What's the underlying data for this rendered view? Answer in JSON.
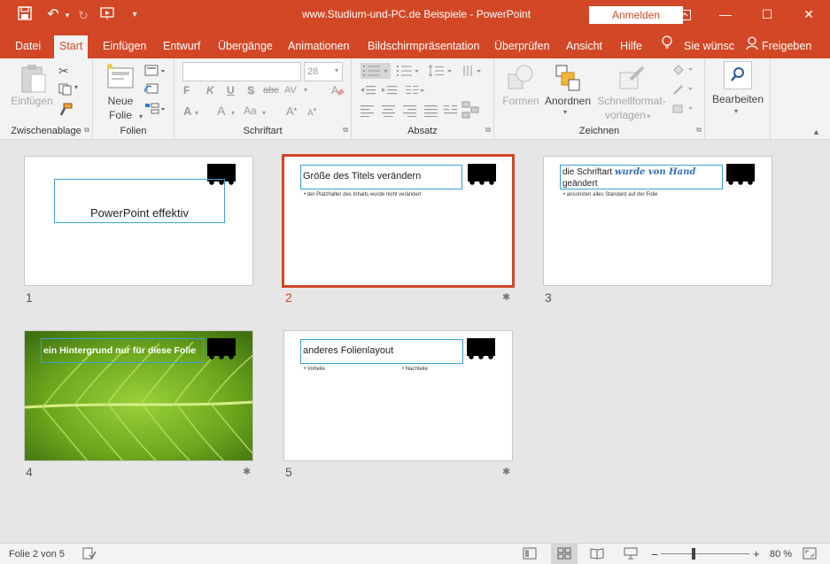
{
  "window": {
    "title": "www.Studium-und-PC.de  Beispiele  -  PowerPoint",
    "sign_in": "Anmelden",
    "restore_glyph": "⧉",
    "minimize_glyph": "—",
    "maximize_glyph": "☐",
    "close_glyph": "✕"
  },
  "qat": {
    "save": "💾",
    "undo": "↶",
    "redo": "↻",
    "present": "▶",
    "customize": "▾"
  },
  "tabs": [
    {
      "label": "Datei"
    },
    {
      "label": "Start"
    },
    {
      "label": "Einfügen"
    },
    {
      "label": "Entwurf"
    },
    {
      "label": "Übergänge"
    },
    {
      "label": "Animationen"
    },
    {
      "label": "Bildschirmpräsentation"
    },
    {
      "label": "Überprüfen"
    },
    {
      "label": "Ansicht"
    },
    {
      "label": "Hilfe"
    }
  ],
  "tell_me": "Sie wünsc",
  "share": "Freigeben",
  "ribbon": {
    "clipboard": {
      "label": "Zwischenablage",
      "paste": "Einfügen"
    },
    "slides": {
      "label": "Folien",
      "new_slide_1": "Neue",
      "new_slide_2": "Folie"
    },
    "font": {
      "label": "Schriftart",
      "font_name": "",
      "font_size": "28",
      "bold": "F",
      "italic": "K",
      "underline": "U",
      "shadow": "S",
      "strike": "abc",
      "spacing": "AV",
      "case": "Aa",
      "grow": "A",
      "shrink": "A"
    },
    "paragraph": {
      "label": "Absatz"
    },
    "drawing": {
      "label": "Zeichnen",
      "shapes": "Formen",
      "arrange": "Anordnen",
      "quick_1": "Schnellformat-",
      "quick_2": "vorlagen"
    },
    "editing": {
      "label": "Bearbeiten"
    }
  },
  "slides": [
    {
      "number": "1",
      "title": "PowerPoint effektiv",
      "selected": false,
      "has_transition": false
    },
    {
      "number": "2",
      "title": "Größe des Titels verändern",
      "bullet": "• der Platzhalter des Inhalts wurde nicht verändert",
      "selected": true,
      "has_transition": true
    },
    {
      "number": "3",
      "title_a": "die Schriftart ",
      "title_b": "wurde von Hand",
      "title_c": "geändert",
      "bullet": "• ansonsten alles Standard auf der Folie",
      "selected": false,
      "has_transition": false
    },
    {
      "number": "4",
      "title": "ein Hintergrund nur für diese Folie",
      "selected": false,
      "has_transition": true
    },
    {
      "number": "5",
      "title": "anderes Folienlayout",
      "bullet_left": "• Vorteile",
      "bullet_right": "• Nachteile",
      "selected": false,
      "has_transition": true
    }
  ],
  "transition_glyph": "✱",
  "status": {
    "slide_info": "Folie 2 von 5",
    "zoom": "80 %",
    "zoom_minus": "−",
    "zoom_plus": "+"
  },
  "colors": {
    "accent": "#d24726",
    "selection_box": "#3aa0d8",
    "leaf_green": "#6aa51c"
  }
}
